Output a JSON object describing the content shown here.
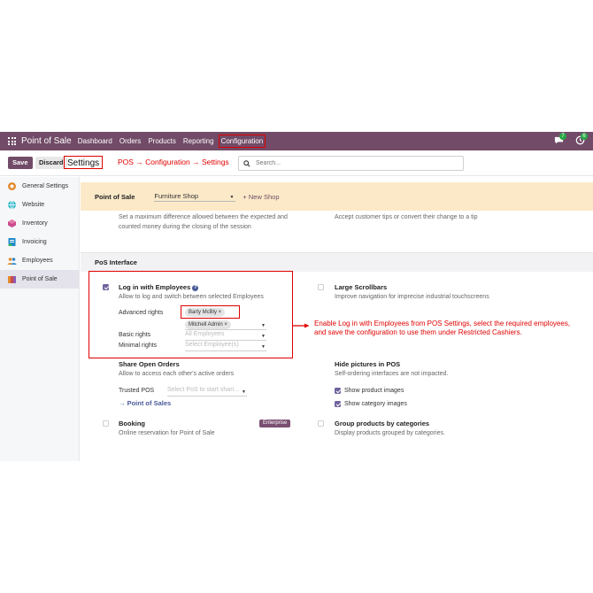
{
  "navbar": {
    "app_name": "Point of Sale",
    "menu": [
      "Dashboard",
      "Orders",
      "Products",
      "Reporting",
      "Configuration"
    ],
    "chat_count": "7",
    "activity_count": "6"
  },
  "control": {
    "save_label": "Save",
    "discard_label": "Discard",
    "breadcrumb": "Settings",
    "annotation": "POS → Configuration → Settings",
    "search_placeholder": "Search..."
  },
  "sidebar": {
    "items": [
      {
        "label": "General Settings",
        "icon": "odoo-logo-icon"
      },
      {
        "label": "Website",
        "icon": "globe-icon"
      },
      {
        "label": "Inventory",
        "icon": "box-icon"
      },
      {
        "label": "Invoicing",
        "icon": "invoice-icon"
      },
      {
        "label": "Employees",
        "icon": "people-icon"
      },
      {
        "label": "Point of Sale",
        "icon": "shop-icon"
      }
    ]
  },
  "pos_bar": {
    "label": "Point of Sale",
    "shop": "Furniture Shop",
    "new_shop": "+ New Shop"
  },
  "top_texts": {
    "left": [
      "Set a maximum difference allowed between the expected and",
      "counted money during the closing of the session"
    ],
    "right": "Accept customer tips or convert their change to a tip"
  },
  "section": {
    "title": "PoS Interface"
  },
  "login_employees": {
    "title": "Log in with Employees",
    "desc": "Allow to log and switch between selected Employees",
    "checked": true,
    "advanced_label": "Advanced rights",
    "advanced_tags": [
      "Barty McBly ×",
      "Mitchell Admin ×"
    ],
    "basic_label": "Basic rights",
    "basic_placeholder": "All Employees",
    "minimal_label": "Minimal rights",
    "minimal_placeholder": "Select Employee(s)"
  },
  "large_scrollbars": {
    "title": "Large Scrollbars",
    "desc": "Improve navigation for imprecise industrial touchscreens",
    "checked": false
  },
  "share_orders": {
    "title": "Share Open Orders",
    "desc": "Allow to access each other's active orders",
    "trusted_label": "Trusted POS",
    "trusted_placeholder": "Select PoS to start shari...",
    "link": "→ Point of Sales"
  },
  "hide_pictures": {
    "title": "Hide pictures in POS",
    "desc": "Self-ordering interfaces are not impacted.",
    "opt1": "Show product images",
    "opt2": "Show category images"
  },
  "booking": {
    "title": "Booking",
    "desc": "Online reservation for Point of Sale",
    "badge": "Enterprise"
  },
  "group_products": {
    "title": "Group products by categories",
    "desc": "Display products grouped by categories."
  },
  "annotation_side": [
    "Enable Log in with Employees from POS Settings, select the required employees,",
    "and save the configuration to use them under Restricted Cashiers."
  ],
  "colors": {
    "brand": "#714b67",
    "annotation": "#e00000",
    "highlight_bar": "#fbe9c8"
  }
}
